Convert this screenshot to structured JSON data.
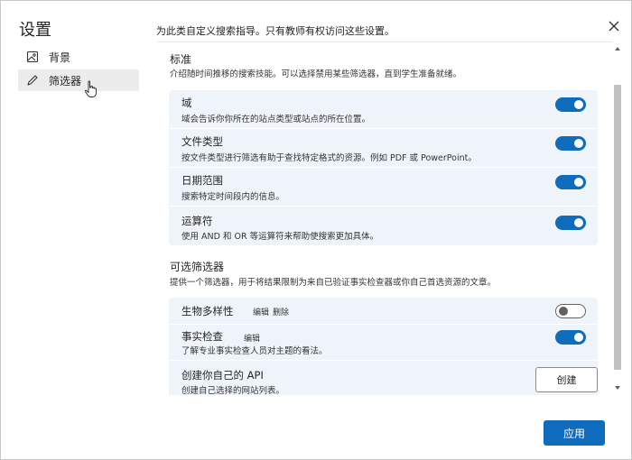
{
  "dialog": {
    "title": "设置",
    "close_icon": "close-icon",
    "intro": "为此类自定义搜索指导。只有教师有权访问这些设置。"
  },
  "sidebar": {
    "items": [
      {
        "label": "背景",
        "icon": "image-icon",
        "selected": false
      },
      {
        "label": "筛选器",
        "icon": "pencil-icon",
        "selected": true
      }
    ]
  },
  "standard": {
    "title": "标准",
    "description": "介绍随时间推移的搜索技能。可以选择禁用某些筛选器，直到学生准备就绪。",
    "rows": [
      {
        "title": "域",
        "description": "域会告诉你你所在的站点类型或站点的所在位置。",
        "enabled": true
      },
      {
        "title": "文件类型",
        "description": "按文件类型进行筛选有助于查找特定格式的资源。例如 PDF 或 PowerPoint。",
        "enabled": true
      },
      {
        "title": "日期范围",
        "description": "搜索特定时间段内的信息。",
        "enabled": true
      },
      {
        "title": "运算符",
        "description": "使用 AND 和 OR 等运算符来帮助使搜索更加具体。",
        "enabled": true
      }
    ]
  },
  "optional": {
    "title": "可选筛选器",
    "description": "提供一个筛选器，用于将结果限制为来自已验证事实检查器或你自己首选资源的文章。",
    "rows": [
      {
        "title": "生物多样性",
        "actions": [
          "编辑",
          "删除"
        ],
        "enabled": false
      },
      {
        "title": "事实检查",
        "actions": [
          "编辑"
        ],
        "description": "了解专业事实检查人员对主题的看法。",
        "enabled": true
      }
    ],
    "create": {
      "title": "创建你自己的 API",
      "description": "创建自己选择的网站列表。",
      "button_label": "创建"
    }
  },
  "footer": {
    "apply_label": "应用"
  },
  "colors": {
    "accent": "#0f6cbd",
    "group_background": "#eff4fb"
  }
}
